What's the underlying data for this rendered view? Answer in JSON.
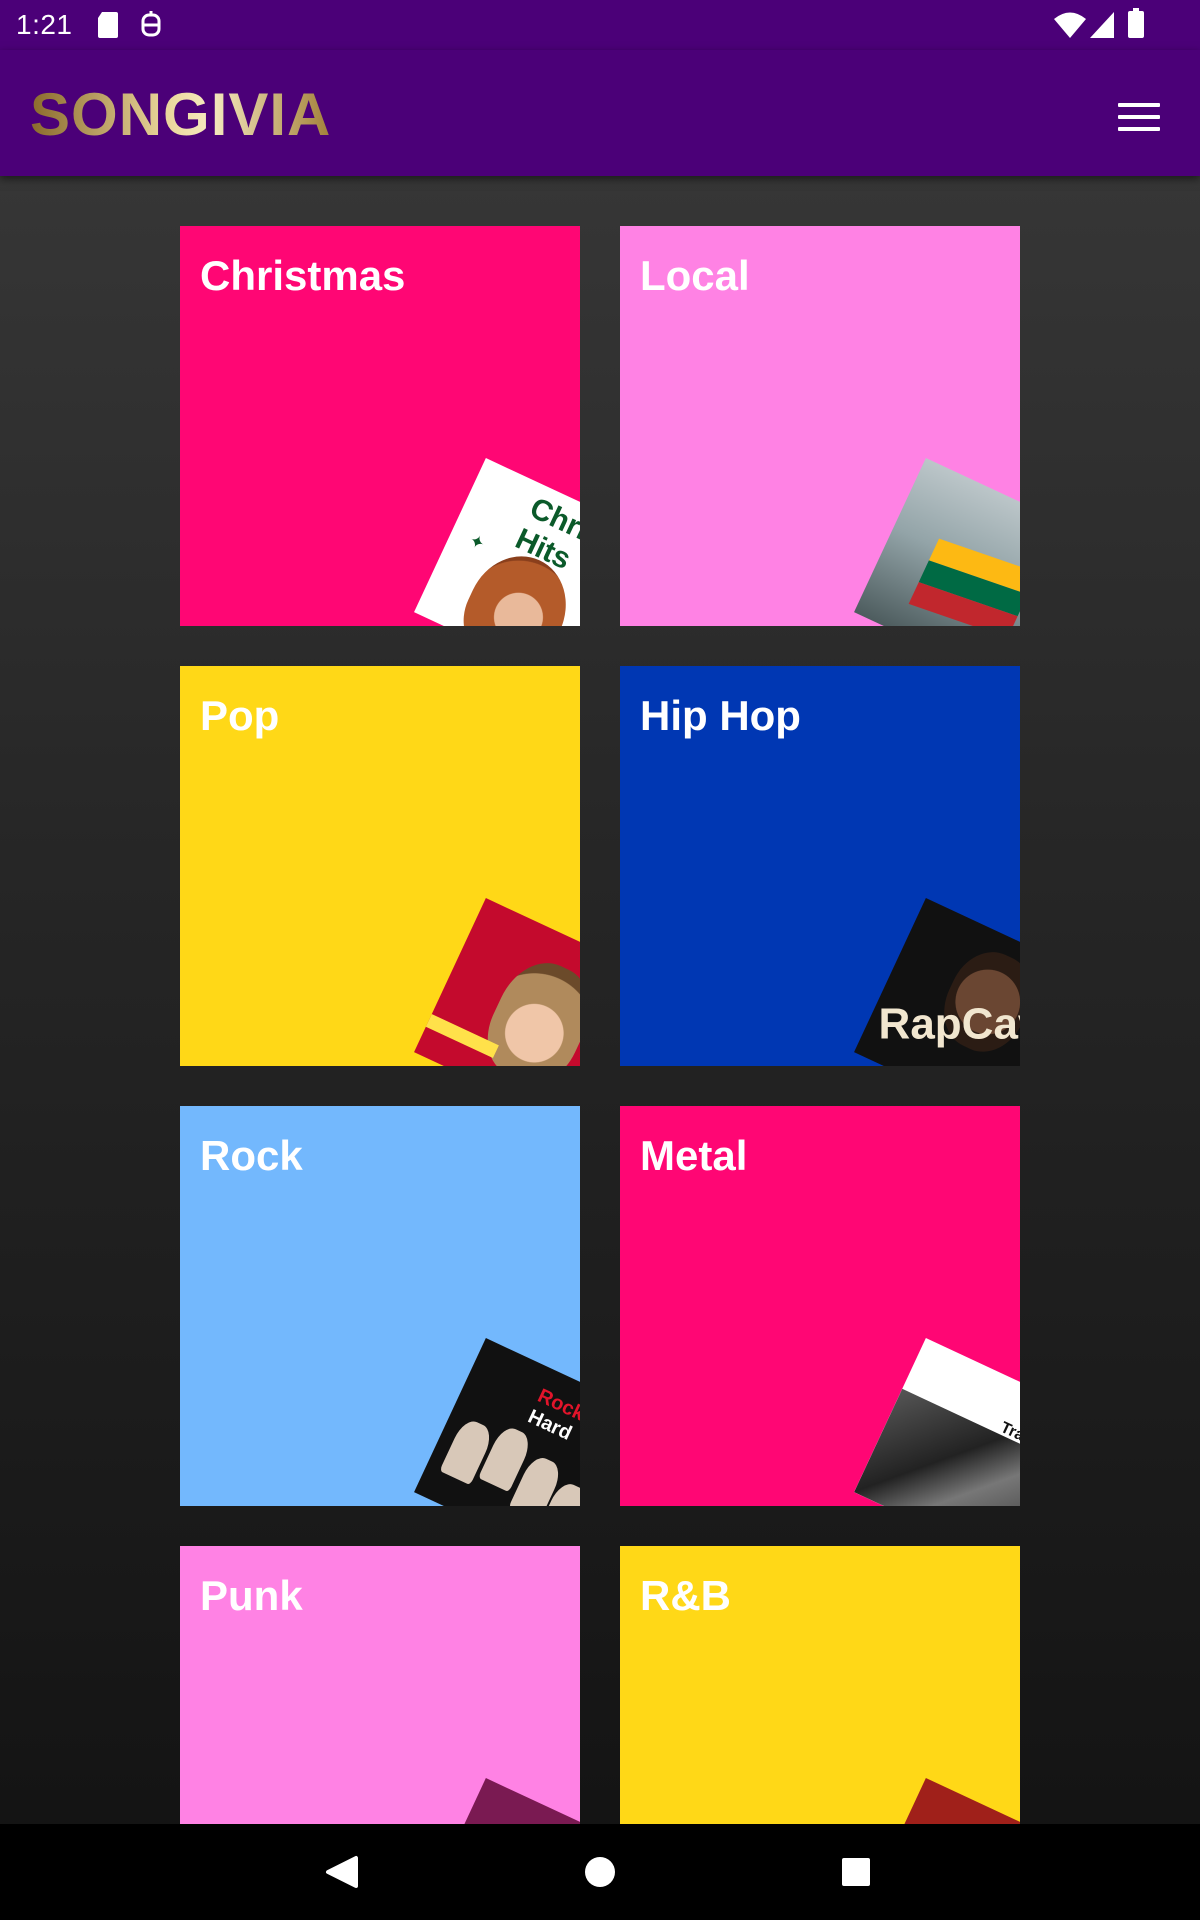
{
  "status_bar": {
    "time": "1:21",
    "left_icons": [
      "sd-card-icon",
      "robot-icon"
    ],
    "right_icons": [
      "wifi-icon",
      "cell-signal-icon",
      "battery-icon"
    ]
  },
  "app_bar": {
    "logo": "SONGIVIA",
    "menu_icon": "hamburger-menu-icon",
    "background": "#4b0078"
  },
  "genres": [
    {
      "label": "Christmas",
      "color": "#ff0674",
      "cover": "Christmas Hits"
    },
    {
      "label": "Local",
      "color": "#ff82e4",
      "cover": ""
    },
    {
      "label": "Pop",
      "color": "#ffd817",
      "cover": ""
    },
    {
      "label": "Hip Hop",
      "color": "#0037b3",
      "cover": "RapCaviar"
    },
    {
      "label": "Rock",
      "color": "#73b8fd",
      "cover_words": [
        "Rock",
        "Hard"
      ]
    },
    {
      "label": "Metal",
      "color": "#ff0674",
      "cover": "Tracks"
    },
    {
      "label": "Punk",
      "color": "#ff82e4",
      "cover": ""
    },
    {
      "label": "R&B",
      "color": "#ffd817",
      "cover": ""
    }
  ],
  "nav_bar": {
    "back_icon": "back-triangle-icon",
    "home_icon": "home-circle-icon",
    "recents_icon": "recents-square-icon"
  }
}
